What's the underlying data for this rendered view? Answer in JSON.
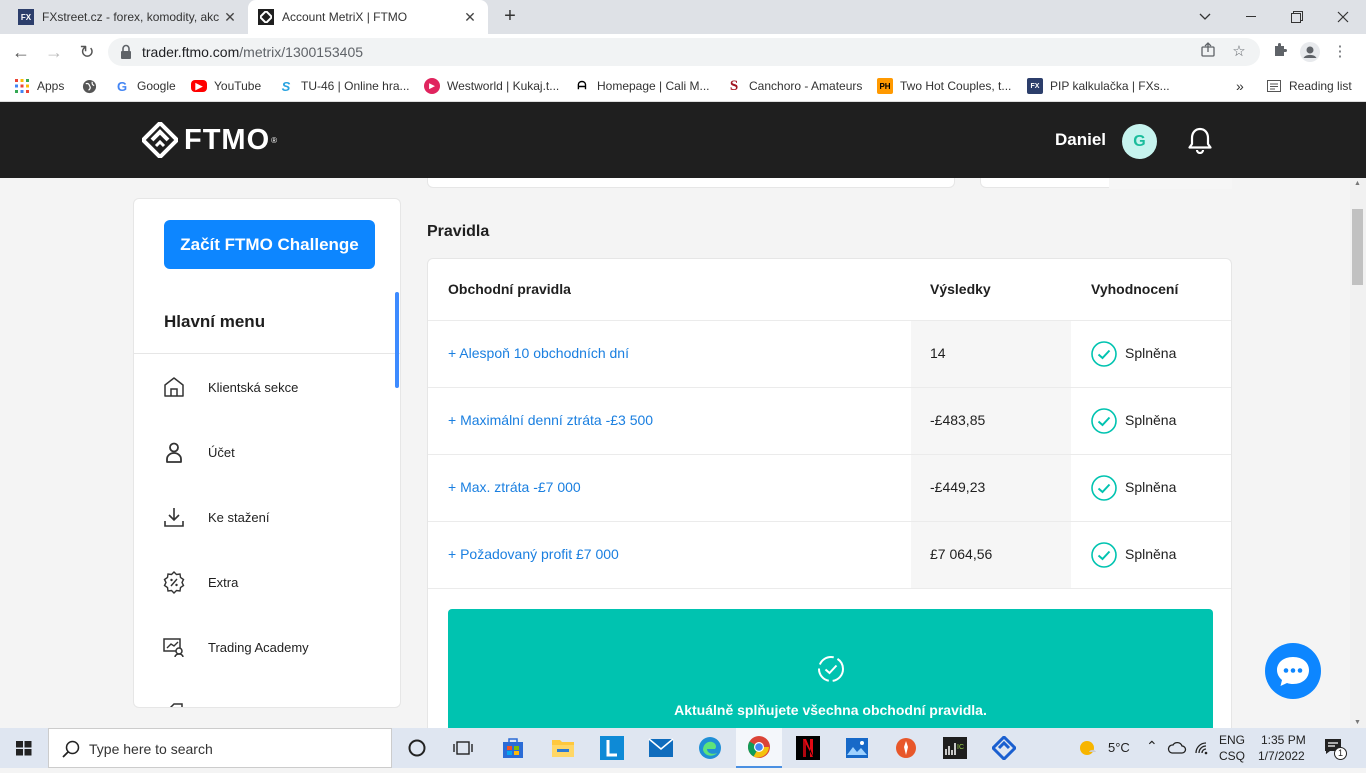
{
  "browser": {
    "tabs": [
      {
        "title": "FXstreet.cz - forex, komodity, akc",
        "favicon": "FX"
      },
      {
        "title": "Account MetriX | FTMO",
        "favicon": "ftmo"
      }
    ],
    "address": {
      "host": "trader.ftmo.com",
      "path": "/metrix/1300153405"
    },
    "bookmarks": [
      {
        "label": "Apps",
        "icon": "apps-grid-icon"
      },
      {
        "label": "",
        "icon": "globe-icon"
      },
      {
        "label": "Google",
        "icon": "google-icon"
      },
      {
        "label": "YouTube",
        "icon": "youtube-icon"
      },
      {
        "label": "TU-46 | Online hra...",
        "icon": "tu46-icon"
      },
      {
        "label": "Westworld | Kukaj.t...",
        "icon": "kukaj-icon"
      },
      {
        "label": "Homepage | Cali M...",
        "icon": "cali-icon"
      },
      {
        "label": "Canchoro - Amateurs",
        "icon": "canchoro-icon"
      },
      {
        "label": "Two Hot Couples, t...",
        "icon": "ph-icon"
      },
      {
        "label": "PIP kalkulačka | FXs...",
        "icon": "fx-icon"
      }
    ],
    "more_bookmarks": "»",
    "reading_list": "Reading list"
  },
  "header": {
    "logo_text": "FTMO",
    "logo_reg": "®",
    "username": "Daniel",
    "avatar_initial": "G"
  },
  "sidebar": {
    "cta_label": "Začít FTMO Challenge",
    "menu_title": "Hlavní menu",
    "items": [
      {
        "label": "Klientská sekce",
        "icon": "home-icon"
      },
      {
        "label": "Účet",
        "icon": "user-icon"
      },
      {
        "label": "Ke stažení",
        "icon": "download-icon"
      },
      {
        "label": "Extra",
        "icon": "percent-badge-icon"
      },
      {
        "label": "Trading Academy",
        "icon": "academy-icon"
      }
    ]
  },
  "rules": {
    "section_title": "Pravidla",
    "columns": [
      "Obchodní pravidla",
      "Výsledky",
      "Vyhodnocení"
    ],
    "rows": [
      {
        "rule": "+ Alespoň 10 obchodních dní",
        "result": "14",
        "status": "Splněna"
      },
      {
        "rule": "+ Maximální denní ztráta -£3 500",
        "result": "-£483,85",
        "status": "Splněna"
      },
      {
        "rule": "+ Max. ztráta -£7 000",
        "result": "-£449,23",
        "status": "Splněna"
      },
      {
        "rule": "+ Požadovaný profit £7 000",
        "result": "£7 064,56",
        "status": "Splněna"
      }
    ],
    "banner_text": "Aktuálně splňujete všechna obchodní pravidla."
  },
  "taskbar": {
    "search_placeholder": "Type here to search",
    "weather": "5°C",
    "lang_top": "ENG",
    "lang_bottom": "CSQ",
    "time": "1:35 PM",
    "date": "1/7/2022",
    "notif_count": "1"
  },
  "colors": {
    "accent": "#0d86ff",
    "success": "#00c3b0",
    "header_bg": "#1f1f1f"
  }
}
